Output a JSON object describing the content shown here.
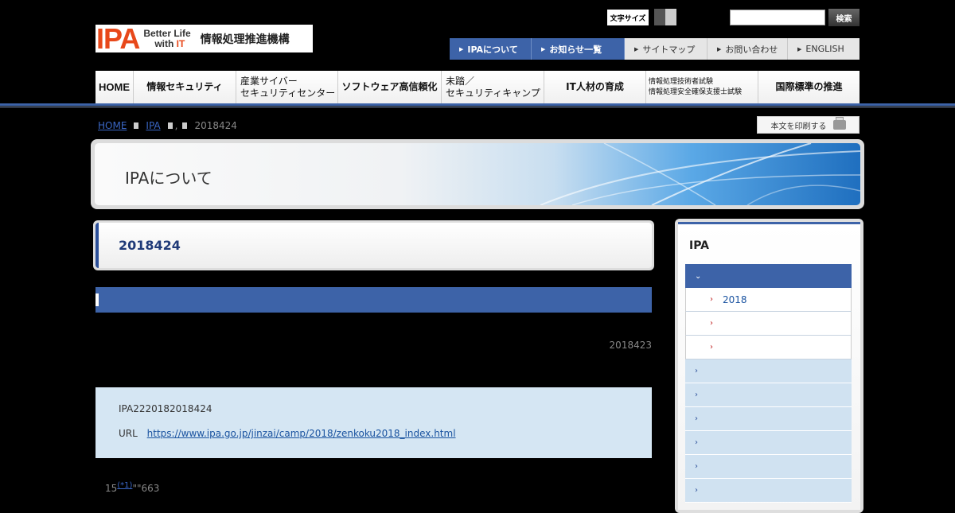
{
  "header": {
    "logo_ipa": "IPA",
    "logo_tag_line1": "Better Life",
    "logo_tag_line2_pre": "with ",
    "logo_tag_line2_it": "IT",
    "org_name": "情報処理推進機構",
    "font_size_label": "文字サイズ",
    "search_placeholder": "",
    "search_button": "検索"
  },
  "util_nav": [
    {
      "label": "IPAについて",
      "style": "blue"
    },
    {
      "label": "お知らせ一覧",
      "style": "blue"
    },
    {
      "label": "サイトマップ",
      "style": "grey"
    },
    {
      "label": "お問い合わせ",
      "style": "grey"
    },
    {
      "label": "ENGLISH",
      "style": "grey"
    }
  ],
  "global_nav": [
    {
      "line1": "HOME",
      "line2": ""
    },
    {
      "line1": "情報セキュリティ",
      "line2": ""
    },
    {
      "line1": "産業サイバー",
      "line2": "セキュリティセンター"
    },
    {
      "line1": "ソフトウェア高信頼化",
      "line2": ""
    },
    {
      "line1": "未踏／",
      "line2": "セキュリティキャンプ"
    },
    {
      "line1": "IT人材の育成",
      "line2": ""
    },
    {
      "line1": "情報処理技術者試験",
      "line2": "情報処理安全確保支援士試験"
    },
    {
      "line1": "国際標準の推進",
      "line2": ""
    }
  ],
  "breadcrumb": {
    "home": "HOME",
    "ipa": "IPA",
    "comma": ",",
    "current": "2018424"
  },
  "print_button": "本文を印刷する",
  "banner_title": "IPAについて",
  "page_title": "2018424",
  "date": "2018423",
  "info": {
    "line1": "IPA2220182018424",
    "url_label": "URL",
    "url": "https://www.ipa.go.jp/jinzai/camp/2018/zenkoku2018_index.html"
  },
  "bottom": {
    "pre": "15",
    "footnote": "(*1)",
    "post": "\"\"663"
  },
  "sidebar": {
    "title": "IPA",
    "items": [
      {
        "label": "",
        "type": "active",
        "chev": "⌄"
      },
      {
        "label": "2018",
        "type": "sub",
        "chev": "›"
      },
      {
        "label": "",
        "type": "sub",
        "chev": "›"
      },
      {
        "label": "",
        "type": "sub",
        "chev": "›"
      },
      {
        "label": "",
        "type": "lv",
        "chev": "›"
      },
      {
        "label": "",
        "type": "lv",
        "chev": "›"
      },
      {
        "label": "",
        "type": "lv",
        "chev": "›"
      },
      {
        "label": "",
        "type": "lv",
        "chev": "›"
      },
      {
        "label": "",
        "type": "lv",
        "chev": "›"
      },
      {
        "label": "",
        "type": "lv",
        "chev": "›"
      }
    ]
  }
}
